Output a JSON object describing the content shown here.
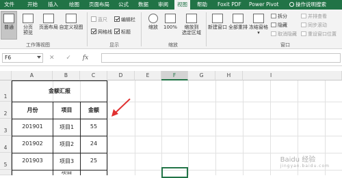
{
  "tabs": [
    {
      "label": "文件"
    },
    {
      "label": "开始"
    },
    {
      "label": "插入"
    },
    {
      "label": "绘图"
    },
    {
      "label": "页面布局"
    },
    {
      "label": "公式"
    },
    {
      "label": "数据"
    },
    {
      "label": "审阅"
    },
    {
      "label": "视图"
    },
    {
      "label": "帮助"
    },
    {
      "label": "Foxit PDF"
    },
    {
      "label": "Power Pivot"
    },
    {
      "label": "操作说明搜索"
    }
  ],
  "ribbon": {
    "views": {
      "normal": "普通",
      "page_break_1": "分页",
      "page_break_2": "预览",
      "page_layout": "页面布局",
      "custom_views": "自定义视图",
      "group_label": "工作簿视图"
    },
    "show": {
      "ruler": "直尺",
      "formula_bar": "编辑栏",
      "gridlines": "网格线",
      "headings": "标题",
      "group_label": "显示"
    },
    "zoom": {
      "zoom": "缩放",
      "hundred": "100%",
      "zoom_sel_1": "缩放到",
      "zoom_sel_2": "选定区域",
      "group_label": "缩放"
    },
    "window": {
      "new_window": "新建窗口",
      "arrange_all": "全部重排",
      "freeze": "冻结窗格",
      "split": "拆分",
      "hide": "隐藏",
      "unhide": "取消隐藏",
      "side_by_side": "并排查看",
      "sync_scroll": "同步滚动",
      "reset_pos": "重设窗口位置",
      "group_label": "窗口"
    }
  },
  "formula_bar": {
    "name_box": "F6",
    "cancel": "✕",
    "enter": "✓",
    "fx": "fx",
    "formula": ""
  },
  "grid": {
    "columns": [
      "A",
      "B",
      "C",
      "D",
      "E",
      "F",
      "G",
      "H",
      "I"
    ],
    "rows": [
      "1",
      "2",
      "3",
      "4",
      "5"
    ],
    "selected_column": "F"
  },
  "table": {
    "title": "金额汇报",
    "headers": [
      "月份",
      "项目",
      "金额"
    ],
    "rows": [
      [
        "201901",
        "项目1",
        "55"
      ],
      [
        "201902",
        "项目2",
        "24"
      ],
      [
        "201903",
        "项目3",
        "25"
      ]
    ],
    "partial_row": [
      "",
      "项目",
      ""
    ]
  },
  "colors": {
    "accent": "#217346",
    "arrow": "#e03030"
  },
  "watermark": {
    "main": "Baidu 经验",
    "sub": "jingyan.baidu.com"
  }
}
